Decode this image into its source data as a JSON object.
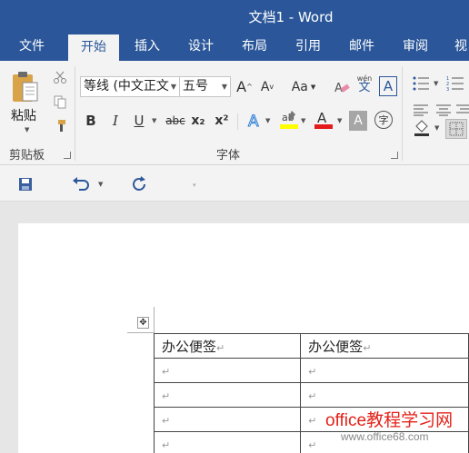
{
  "window": {
    "title": "文档1 - Word"
  },
  "tabs": [
    "文件",
    "开始",
    "插入",
    "设计",
    "布局",
    "引用",
    "邮件",
    "审阅",
    "视"
  ],
  "clipboard": {
    "paste_label": "粘贴",
    "group_label": "剪贴板"
  },
  "font": {
    "group_label": "字体",
    "family": "等线 (中文正文",
    "size": "五号",
    "change_case": "Aa",
    "phonetic_top": "wén",
    "phonetic_bottom": "文",
    "border_char": "A",
    "bold": "B",
    "italic": "I",
    "underline": "U",
    "strike": "abc",
    "subscript": "x₂",
    "superscript": "x²",
    "enclose": "字",
    "highlight_color": "#ffff00",
    "font_color": "#e31b1b"
  },
  "document": {
    "table": [
      [
        "办公便签",
        "办公便签"
      ],
      [
        "",
        ""
      ],
      [
        "",
        ""
      ],
      [
        "",
        ""
      ],
      [
        "",
        ""
      ]
    ],
    "mark": "↵"
  },
  "watermark": {
    "main": "office教程学习网",
    "url": "www.office68.com"
  },
  "colors": {
    "accent": "#2b579a",
    "ribbon": "#f3f3f3"
  }
}
